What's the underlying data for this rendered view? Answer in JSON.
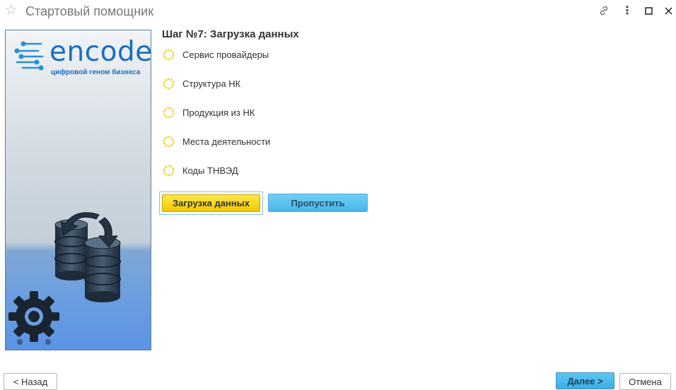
{
  "window": {
    "title": "Стартовый помощник",
    "icons": {
      "favorite": "star-icon",
      "link": "link-icon",
      "menu": "more-vertical-icon",
      "maximize": "maximize-icon",
      "close": "close-icon"
    }
  },
  "sidebar": {
    "logo_text": "encode",
    "logo_tagline": "цифровой геном бизнеса",
    "illustration": "database-sync-gear-illustration"
  },
  "main": {
    "step_title": "Шаг №7: Загрузка данных",
    "items": [
      {
        "label": "Сервис провайдеры",
        "status_icon": "loading-spinner-icon"
      },
      {
        "label": "Структура НК",
        "status_icon": "loading-spinner-icon"
      },
      {
        "label": "Продукция из НК",
        "status_icon": "loading-spinner-icon"
      },
      {
        "label": "Места деятельности",
        "status_icon": "loading-spinner-icon"
      },
      {
        "label": "Коды ТНВЭД",
        "status_icon": "loading-spinner-icon"
      }
    ],
    "load_button": "Загрузка данных",
    "skip_button": "Пропустить"
  },
  "footer": {
    "back_button": "< Назад",
    "next_button": "Далее >",
    "cancel_button": "Отмена"
  },
  "colors": {
    "accent_yellow": "#f4c800",
    "accent_blue": "#48b6ea",
    "logo_blue": "#1a6fc0"
  }
}
